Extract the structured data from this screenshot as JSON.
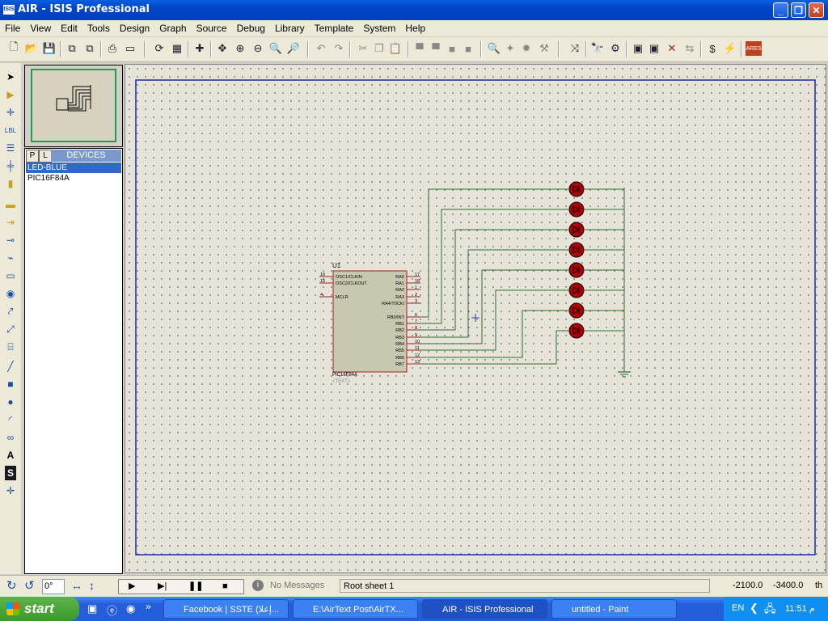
{
  "window": {
    "title": "AIR - ISIS Professional",
    "icon": "isis-app-icon",
    "controls": [
      "_",
      "❐",
      "✕"
    ]
  },
  "menu": [
    "File",
    "View",
    "Edit",
    "Tools",
    "Design",
    "Graph",
    "Source",
    "Debug",
    "Library",
    "Template",
    "System",
    "Help"
  ],
  "left_panel": {
    "tabs": [
      "P",
      "L"
    ],
    "header": "DEVICES",
    "devices": [
      "LED-BLUE",
      "PIC16F84A"
    ],
    "selected_index": 0
  },
  "schematic": {
    "component_ref": "U1",
    "component_part": "PIC16F84A",
    "component_text": "<TEXT>",
    "left_pins": [
      {
        "num": "16",
        "name": "OSC1/CLKIN"
      },
      {
        "num": "15",
        "name": "OSC2/CLKOUT"
      },
      {
        "num": "4",
        "name": "MCLR"
      }
    ],
    "right_pins": [
      {
        "num": "17",
        "name": "RA0"
      },
      {
        "num": "18",
        "name": "RA1"
      },
      {
        "num": "1",
        "name": "RA2"
      },
      {
        "num": "2",
        "name": "RA3"
      },
      {
        "num": "3",
        "name": "RA4/T0CKI"
      },
      {
        "num": "6",
        "name": "RB0/INT"
      },
      {
        "num": "7",
        "name": "RB1"
      },
      {
        "num": "8",
        "name": "RB2"
      },
      {
        "num": "9",
        "name": "RB3"
      },
      {
        "num": "10",
        "name": "RB4"
      },
      {
        "num": "11",
        "name": "RB5"
      },
      {
        "num": "12",
        "name": "RB6"
      },
      {
        "num": "13",
        "name": "RB7"
      }
    ],
    "led_count": 8
  },
  "status": {
    "rotation": "0°",
    "messages": "No Messages",
    "sheet": "Root sheet 1",
    "coord_x": "-2100.0",
    "coord_y": "-3400.0",
    "units": "th"
  },
  "taskbar": {
    "start": "start",
    "tasks": [
      {
        "label": "Facebook | SSTE (إعلا...",
        "active": false
      },
      {
        "label": "E:\\AirText Post\\AirTX...",
        "active": false
      },
      {
        "label": "AIR - ISIS Professional",
        "active": true
      },
      {
        "label": "untitled - Paint",
        "active": false
      }
    ],
    "lang": "EN",
    "clock": "11:51 م"
  },
  "colors": {
    "wire": "#2f6d2f",
    "component_fill": "#c8c8b0",
    "component_border": "#a02020",
    "led": "#b00000",
    "sheet_border": "#1a2aa8"
  }
}
